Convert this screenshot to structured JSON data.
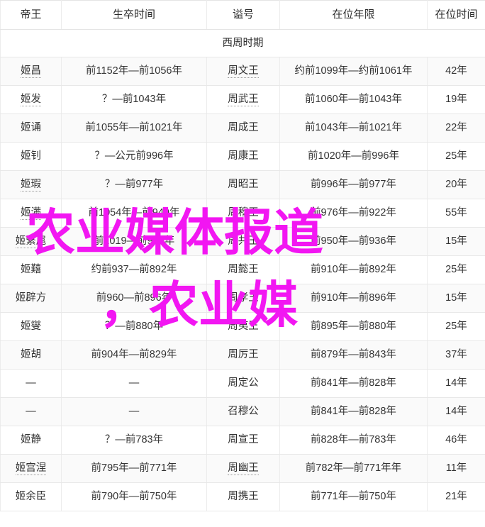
{
  "table": {
    "headers": [
      "帝王",
      "生卒时间",
      "谥号",
      "在位年限",
      "在位时间"
    ],
    "era_label": "西周时期",
    "rows": [
      {
        "name": "姬昌",
        "life": "前1152年—前1056年",
        "posthumous": "周文王",
        "reign_range": "约前1099年—约前1061年",
        "reign_years": "42年"
      },
      {
        "name": "姬发",
        "life": "？—前1043年",
        "posthumous": "周武王",
        "reign_range": "前1060年—前1043年",
        "reign_years": "19年"
      },
      {
        "name": "姬诵",
        "life": "前1055年—前1021年",
        "posthumous": "周成王",
        "reign_range": "前1043年—前1021年",
        "reign_years": "22年"
      },
      {
        "name": "姬钊",
        "life": "？—公元前996年",
        "posthumous": "周康王",
        "reign_range": "前1020年—前996年",
        "reign_years": "25年"
      },
      {
        "name": "姬瑕",
        "life": "？—前977年",
        "posthumous": "周昭王",
        "reign_range": "前996年—前977年",
        "reign_years": "20年"
      },
      {
        "name": "姬满",
        "life": "前1054年—前949年",
        "posthumous": "周穆王",
        "reign_range": "前976年—前922年",
        "reign_years": "55年"
      },
      {
        "name": "姬繄扈",
        "life": "前1019—前936年",
        "posthumous": "周共王",
        "reign_range": "前950年—前936年",
        "reign_years": "15年"
      },
      {
        "name": "姬囏",
        "life": "约前937—前892年",
        "posthumous": "周懿王",
        "reign_range": "前910年—前892年",
        "reign_years": "25年"
      },
      {
        "name": "姬辟方",
        "life": "前960—前896年",
        "posthumous": "周孝王",
        "reign_range": "前910年—前896年",
        "reign_years": "15年"
      },
      {
        "name": "姬燮",
        "life": "？—前880年",
        "posthumous": "周夷王",
        "reign_range": "前895年—前880年",
        "reign_years": "25年"
      },
      {
        "name": "姬胡",
        "life": "前904年—前829年",
        "posthumous": "周厉王",
        "reign_range": "前879年—前843年",
        "reign_years": "37年"
      },
      {
        "name": "—",
        "life": "—",
        "posthumous": "周定公",
        "reign_range": "前841年—前828年",
        "reign_years": "14年"
      },
      {
        "name": "—",
        "life": "—",
        "posthumous": "召穆公",
        "reign_range": "前841年—前828年",
        "reign_years": "14年"
      },
      {
        "name": "姬静",
        "life": "？—前783年",
        "posthumous": "周宣王",
        "reign_range": "前828年—前783年",
        "reign_years": "46年"
      },
      {
        "name": "姬宫涅",
        "life": "前795年—前771年",
        "posthumous": "周幽王",
        "reign_range": "前782年—前771年年",
        "reign_years": "11年"
      },
      {
        "name": "姬余臣",
        "life": "前790年—前750年",
        "posthumous": "周携王",
        "reign_range": "前771年—前750年",
        "reign_years": "21年"
      }
    ]
  },
  "watermark": {
    "line1": "农业媒体报道",
    "line2": "，农业媒",
    "color": "#f216f2"
  }
}
